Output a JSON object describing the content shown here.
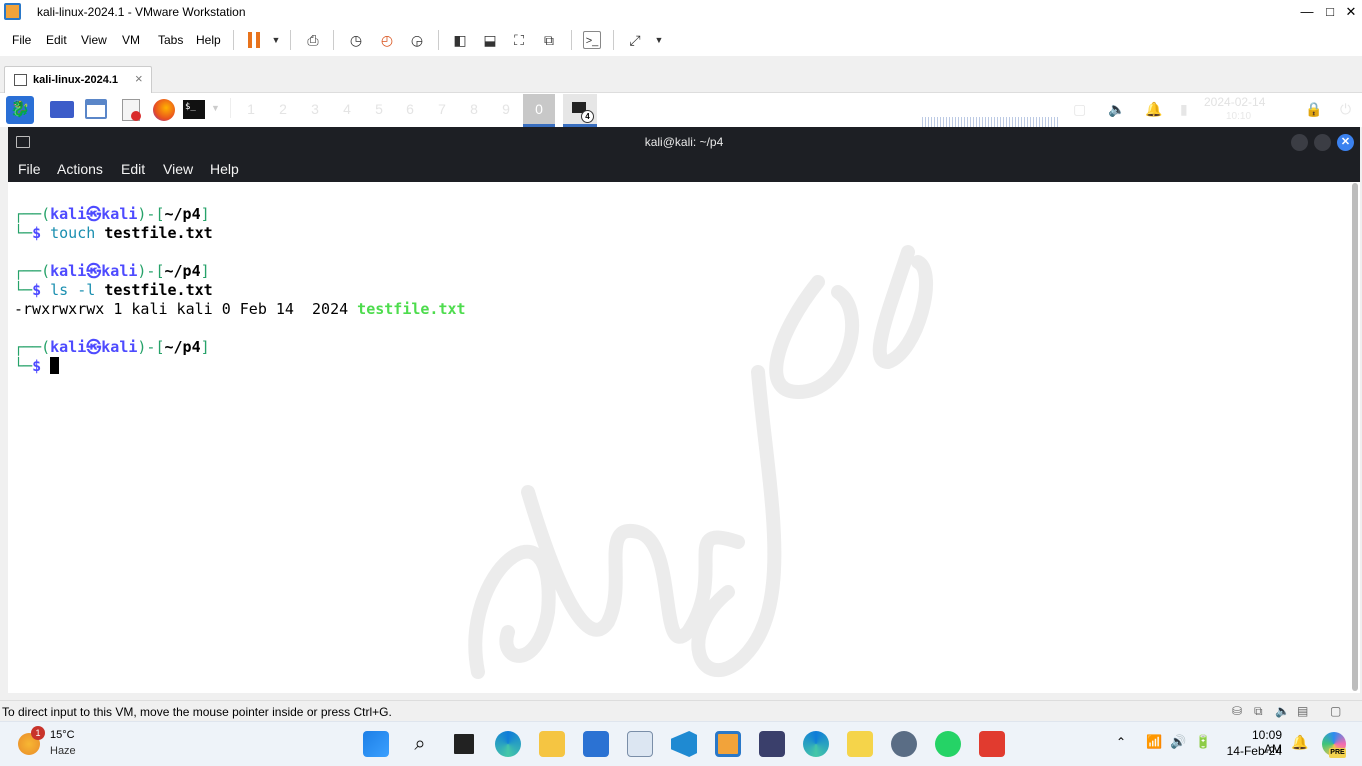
{
  "window": {
    "title": "kali-linux-2024.1 - VMware Workstation",
    "minimize": "—",
    "maximize": "□",
    "close": "✕"
  },
  "vmware_menu": [
    "File",
    "Edit",
    "View",
    "VM",
    "Tabs",
    "Help"
  ],
  "vm_tab": {
    "label": "kali-linux-2024.1",
    "close": "×"
  },
  "kali_panel": {
    "workspaces": [
      "1",
      "2",
      "3",
      "4",
      "5",
      "6",
      "7",
      "8",
      "9"
    ],
    "active_workspace": "0",
    "terminal_window_count": "4",
    "date": "2024-02-14",
    "time": "10:10"
  },
  "terminal": {
    "title": "kali@kali: ~/p4",
    "menu": [
      "File",
      "Actions",
      "Edit",
      "View",
      "Help"
    ],
    "prompt": {
      "user": "kali",
      "at": "㉿",
      "host": "kali",
      "cwd": "~/p4",
      "dollar": "$"
    },
    "lines": {
      "cmd1": {
        "command": "touch",
        "arg": "testfile.txt"
      },
      "cmd2": {
        "command": "ls -l",
        "arg": "testfile.txt"
      },
      "output": {
        "listing": "-rwxrwxrwx 1 kali kali 0 Feb 14  2024 ",
        "filename": "testfile.txt"
      }
    },
    "watermark": "dmj.one"
  },
  "status_bar": {
    "text": "To direct input to this VM, move the mouse pointer inside or press Ctrl+G."
  },
  "taskbar": {
    "weather": {
      "temp": "15°C",
      "condition": "Haze",
      "badge": "1"
    },
    "clock": {
      "time": "10:09 AM",
      "date": "14-Feb-24"
    },
    "copilot_badge": "PRE"
  },
  "colors": {
    "accent": "#3a6fbf",
    "prompt_green": "#26a269",
    "prompt_blue": "#4e4bff",
    "file_green": "#4ddc4d",
    "terminal_bar": "#1d1f24"
  }
}
